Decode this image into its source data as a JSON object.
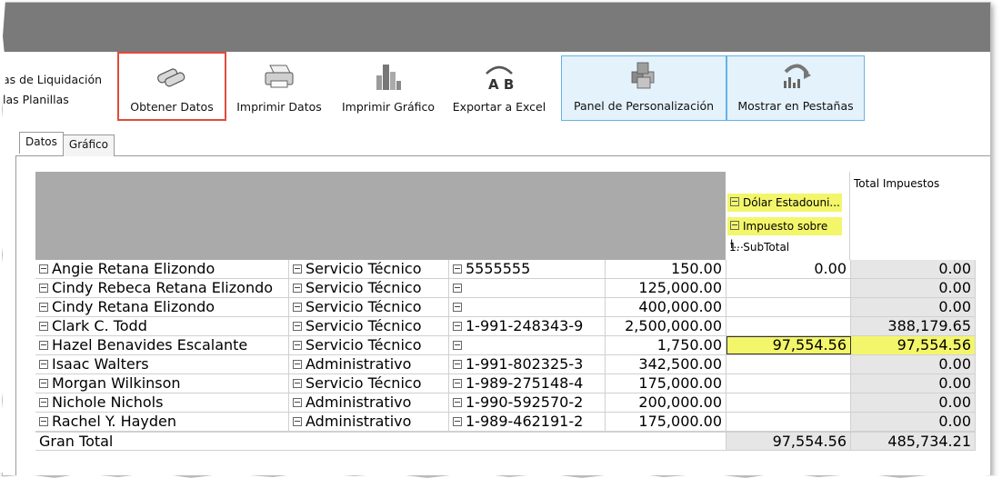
{
  "left_links": [
    "as de Liquidación",
    "las Planillas"
  ],
  "toolbar": [
    {
      "label": "Obtener Datos",
      "icon": "binoculars-icon"
    },
    {
      "label": "Imprimir Datos",
      "icon": "printer-icon"
    },
    {
      "label": "Imprimir Gráfico",
      "icon": "bar-chart-icon"
    },
    {
      "label": "Exportar a Excel",
      "icon": "ab-text-icon"
    },
    {
      "label": "Panel de Personalización",
      "icon": "cubes-icon"
    },
    {
      "label": "Mostrar en Pestañas",
      "icon": "chart-arrow-icon"
    }
  ],
  "tabs": [
    "Datos",
    "Gráfico"
  ],
  "pivot_header": {
    "dollar_field": "Dólar Estadouni...",
    "tax_field": "Impuesto sobre l...",
    "subtotal": "1. SubTotal",
    "total_col": "Total Impuestos"
  },
  "rows": [
    {
      "name": "Angie Retana Elizondo",
      "dept": "Servicio Técnico",
      "id": "5555555",
      "amount": "150.00",
      "subtotal": "0.00",
      "total": "0.00"
    },
    {
      "name": "Cindy Rebeca Retana Elizondo",
      "dept": "Servicio Técnico",
      "id": "",
      "amount": "125,000.00",
      "subtotal": "",
      "total": "0.00"
    },
    {
      "name": "Cindy Retana Elizondo",
      "dept": "Servicio Técnico",
      "id": "",
      "amount": "400,000.00",
      "subtotal": "",
      "total": "0.00"
    },
    {
      "name": "Clark C. Todd",
      "dept": "Servicio Técnico",
      "id": "1-991-248343-9",
      "amount": "2,500,000.00",
      "subtotal": "",
      "total": "388,179.65"
    },
    {
      "name": "Hazel Benavides Escalante",
      "dept": "Servicio Técnico",
      "id": "",
      "amount": "1,750.00",
      "subtotal": "97,554.56",
      "total": "97,554.56"
    },
    {
      "name": "Isaac Walters",
      "dept": "Administrativo",
      "id": "1-991-802325-3",
      "amount": "342,500.00",
      "subtotal": "",
      "total": "0.00"
    },
    {
      "name": "Morgan Wilkinson",
      "dept": "Servicio Técnico",
      "id": "1-989-275148-4",
      "amount": "175,000.00",
      "subtotal": "",
      "total": "0.00"
    },
    {
      "name": "Nichole Nichols",
      "dept": "Administrativo",
      "id": "1-990-592570-2",
      "amount": "200,000.00",
      "subtotal": "",
      "total": "0.00"
    },
    {
      "name": "Rachel Y. Hayden",
      "dept": "Administrativo",
      "id": "1-989-462191-2",
      "amount": "175,000.00",
      "subtotal": "",
      "total": "0.00"
    }
  ],
  "grand_total": {
    "label": "Gran Total",
    "subtotal": "97,554.56",
    "total": "485,734.21"
  }
}
